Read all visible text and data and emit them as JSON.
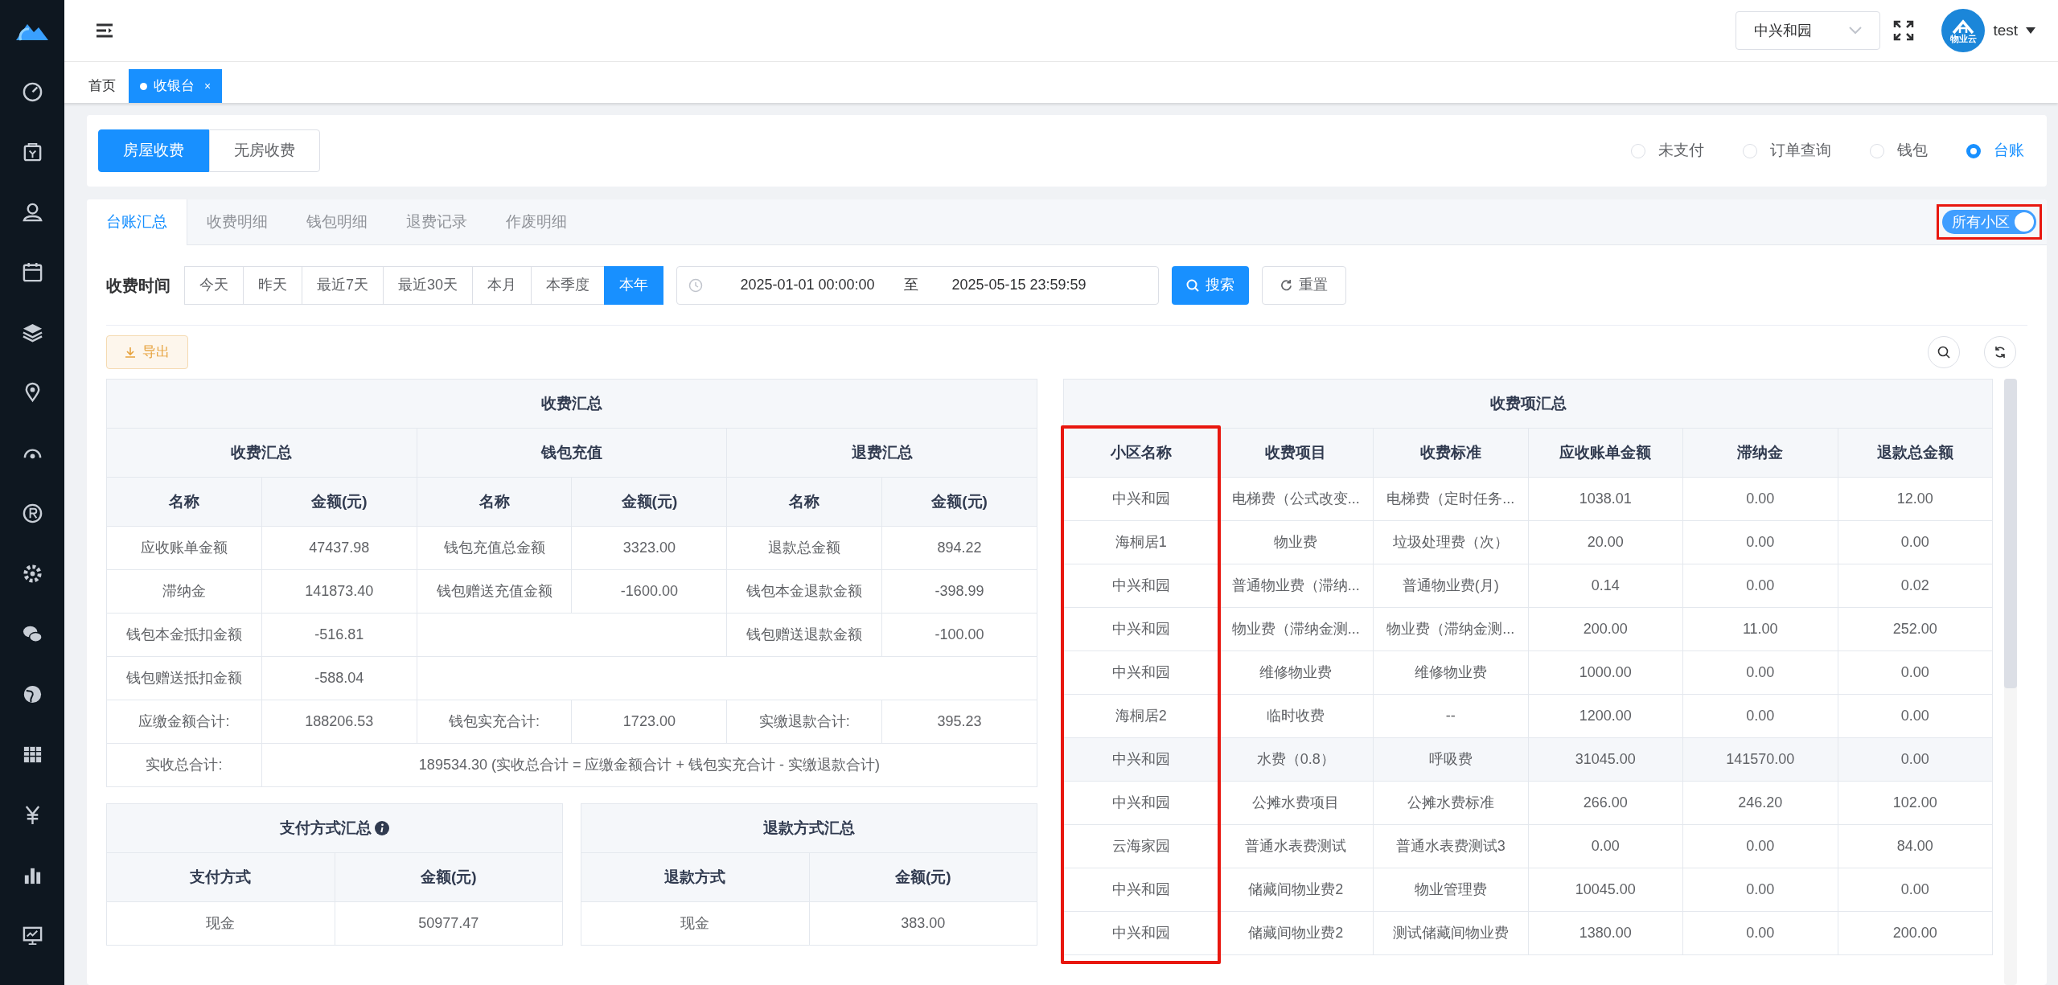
{
  "header": {
    "community_select": "中兴和园",
    "logo_caption": "物业云",
    "user": "test"
  },
  "tags": [
    {
      "label": "首页",
      "selected": false
    },
    {
      "label": "收银台",
      "selected": true,
      "close": "×"
    }
  ],
  "mode_buttons": [
    {
      "label": "房屋收费",
      "selected": true
    },
    {
      "label": "无房收费",
      "selected": false
    }
  ],
  "view_radios": [
    {
      "label": "未支付",
      "selected": false
    },
    {
      "label": "订单查询",
      "selected": false
    },
    {
      "label": "钱包",
      "selected": false
    },
    {
      "label": "台账",
      "selected": true
    }
  ],
  "tabs": [
    {
      "label": "台账汇总",
      "selected": true
    },
    {
      "label": "收费明细",
      "selected": false
    },
    {
      "label": "钱包明细",
      "selected": false
    },
    {
      "label": "退费记录",
      "selected": false
    },
    {
      "label": "作废明细",
      "selected": false
    }
  ],
  "all_communities_toggle": {
    "label": "所有小区",
    "on": true,
    "highlighted": true
  },
  "filter": {
    "label": "收费时间",
    "quick_ranges": [
      {
        "label": "今天",
        "selected": false
      },
      {
        "label": "昨天",
        "selected": false
      },
      {
        "label": "最近7天",
        "selected": false
      },
      {
        "label": "最近30天",
        "selected": false
      },
      {
        "label": "本月",
        "selected": false
      },
      {
        "label": "本季度",
        "selected": false
      },
      {
        "label": "本年",
        "selected": true
      }
    ],
    "start": "2025-01-01 00:00:00",
    "separator": "至",
    "end": "2025-05-15 23:59:59",
    "search_button": "搜索",
    "reset_button": "重置"
  },
  "export_button": "导出",
  "fee_summary": {
    "title": "收费汇总",
    "groups": [
      "收费汇总",
      "钱包充值",
      "退费汇总"
    ],
    "columns": [
      "名称",
      "金额(元)",
      "名称",
      "金额(元)",
      "名称",
      "金额(元)"
    ],
    "rows": [
      [
        "应收账单金额",
        "47437.98",
        "钱包充值总金额",
        "3323.00",
        "退款总金额",
        "894.22"
      ],
      [
        "滞纳金",
        "141873.40",
        "钱包赠送充值金额",
        "-1600.00",
        "钱包本金退款金额",
        "-398.99"
      ],
      [
        "钱包本金抵扣金额",
        "-516.81",
        null,
        null,
        "钱包赠送退款金额",
        "-100.00"
      ],
      [
        "钱包赠送抵扣金额",
        "-588.04",
        null,
        null,
        null,
        null
      ],
      [
        "应缴金额合计:",
        "188206.53",
        "钱包实充合计:",
        "1723.00",
        "实缴退款合计:",
        "395.23"
      ]
    ],
    "total": {
      "label": "实收总合计:",
      "value": "189534.30 (实收总合计 = 应缴金额合计 + 钱包实充合计 - 实缴退款合计)"
    }
  },
  "method_summaries": [
    {
      "title": "支付方式汇总",
      "has_info": true,
      "columns": [
        "支付方式",
        "金额(元)"
      ],
      "rows": [
        [
          "现金",
          "50977.47"
        ]
      ]
    },
    {
      "title": "退款方式汇总",
      "has_info": false,
      "columns": [
        "退款方式",
        "金额(元)"
      ],
      "rows": [
        [
          "现金",
          "383.00"
        ]
      ]
    }
  ],
  "item_summary": {
    "title": "收费项汇总",
    "columns": [
      {
        "label": "小区名称",
        "highlighted": true
      },
      {
        "label": "收费项目",
        "highlighted": false
      },
      {
        "label": "收费标准",
        "highlighted": false
      },
      {
        "label": "应收账单金额",
        "highlighted": false
      },
      {
        "label": "滞纳金",
        "highlighted": false
      },
      {
        "label": "退款总金额",
        "highlighted": false
      }
    ],
    "rows": [
      {
        "cells": [
          "中兴和园",
          "电梯费（公式改变...",
          "电梯费（定时任务...",
          "1038.01",
          "0.00",
          "12.00"
        ],
        "hovered": false
      },
      {
        "cells": [
          "海桐居1",
          "物业费",
          "垃圾处理费（次）",
          "20.00",
          "0.00",
          "0.00"
        ],
        "hovered": false
      },
      {
        "cells": [
          "中兴和园",
          "普通物业费（滞纳...",
          "普通物业费(月)",
          "0.14",
          "0.00",
          "0.02"
        ],
        "hovered": false
      },
      {
        "cells": [
          "中兴和园",
          "物业费（滞纳金测...",
          "物业费（滞纳金测...",
          "200.00",
          "11.00",
          "252.00"
        ],
        "hovered": false
      },
      {
        "cells": [
          "中兴和园",
          "维修物业费",
          "维修物业费",
          "1000.00",
          "0.00",
          "0.00"
        ],
        "hovered": false
      },
      {
        "cells": [
          "海桐居2",
          "临时收费",
          "--",
          "1200.00",
          "0.00",
          "0.00"
        ],
        "hovered": false
      },
      {
        "cells": [
          "中兴和园",
          "水费（0.8）",
          "呼吸费",
          "31045.00",
          "141570.00",
          "0.00"
        ],
        "hovered": true
      },
      {
        "cells": [
          "中兴和园",
          "公摊水费项目",
          "公摊水费标准",
          "266.00",
          "246.20",
          "102.00"
        ],
        "hovered": false
      },
      {
        "cells": [
          "云海家园",
          "普通水表费测试",
          "普通水表费测试3",
          "0.00",
          "0.00",
          "84.00"
        ],
        "hovered": false
      },
      {
        "cells": [
          "中兴和园",
          "储藏间物业费2",
          "物业管理费",
          "10045.00",
          "0.00",
          "0.00"
        ],
        "hovered": false
      },
      {
        "cells": [
          "中兴和园",
          "储藏间物业费2",
          "测试储藏间物业费",
          "1380.00",
          "0.00",
          "200.00"
        ],
        "hovered": false
      }
    ]
  }
}
